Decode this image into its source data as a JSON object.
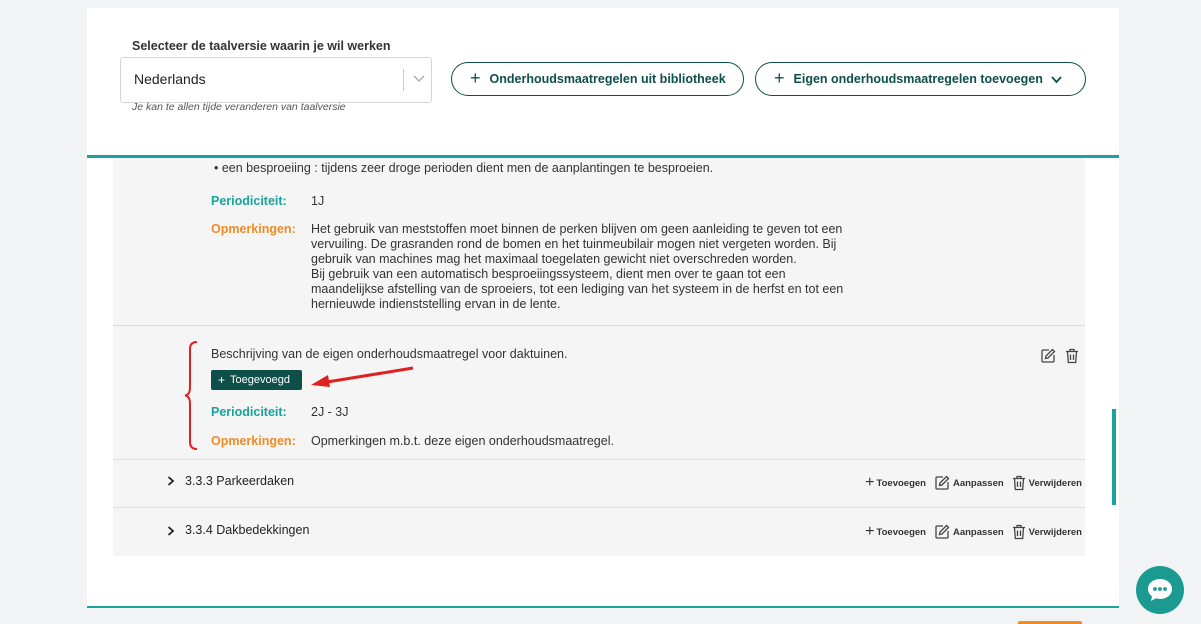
{
  "header": {
    "language_label": "Selecteer de taalversie waarin je wil werken",
    "language_value": "Nederlands",
    "language_hint": "Je kan te allen tijde veranderen van taalversie",
    "library_button": "Onderhoudsmaatregelen uit bibliotheek",
    "own_button": "Eigen onderhoudsmaatregelen toevoegen"
  },
  "measure1": {
    "bullet": "• een besproeiing : tijdens zeer droge perioden dient men de aanplantingen te besproeien.",
    "periodicity_label": "Periodiciteit:",
    "periodicity_value": "1J",
    "remarks_label": "Opmerkingen:",
    "remarks_lines": [
      "Het gebruik van meststoffen moet binnen de perken blijven om geen aanleiding te geven tot een",
      "vervuiling. De grasranden rond de bomen en het tuinmeubilair mogen niet vergeten worden. Bij",
      "gebruik van machines mag het maximaal toegelaten gewicht niet overschreden worden.",
      "Bij gebruik van een automatisch besproeiingssysteem, dient men over te gaan tot een",
      "maandelijkse afstelling van de sproeiers, tot een lediging van het systeem in de herfst en tot een",
      "hernieuwde indienststelling ervan in de lente."
    ]
  },
  "measure2": {
    "description": "Beschrijving van de eigen onderhoudsmaatregel voor daktuinen.",
    "badge": "Toegevoegd",
    "periodicity_label": "Periodiciteit:",
    "periodicity_value": "2J - 3J",
    "remarks_label": "Opmerkingen:",
    "remarks_value": "Opmerkingen m.b.t. deze eigen onderhoudsmaatregel."
  },
  "sections": [
    {
      "title": "3.3.3 Parkeerdaken",
      "add": "Toevoegen",
      "edit": "Aanpassen",
      "delete": "Verwijderen"
    },
    {
      "title": "3.3.4 Dakbedekkingen",
      "add": "Toevoegen",
      "edit": "Aanpassen",
      "delete": "Verwijderen"
    }
  ],
  "colors": {
    "teal": "#1aa39a",
    "dark_green": "#0f4f49",
    "orange": "#f08a24",
    "annotation_red": "#e02020"
  }
}
